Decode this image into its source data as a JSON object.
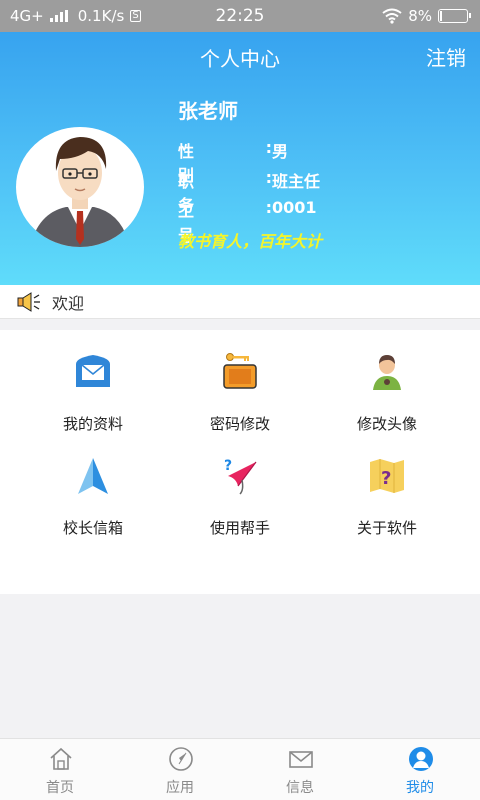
{
  "status_bar": {
    "network": "4G+",
    "speed": "0.1K/s",
    "sim": "S",
    "time": "22:25",
    "battery_percent": "8%",
    "battery_level": 0.08
  },
  "header": {
    "title": "个人中心",
    "logout": "注销",
    "name": "张老师",
    "fields": [
      {
        "key": "性别",
        "value": "男"
      },
      {
        "key": "职务",
        "value": "班主任"
      },
      {
        "key": "工号",
        "value": "0001"
      }
    ],
    "motto": "教书育人，百年大计"
  },
  "welcome": {
    "text": "欢迎"
  },
  "grid": {
    "items": [
      {
        "label": "我的资料",
        "icon": "mail-icon"
      },
      {
        "label": "密码修改",
        "icon": "key-briefcase-icon"
      },
      {
        "label": "修改头像",
        "icon": "user-avatar-icon"
      },
      {
        "label": "校长信箱",
        "icon": "navigation-arrow-icon"
      },
      {
        "label": "使用帮手",
        "icon": "help-umbrella-icon"
      },
      {
        "label": "关于软件",
        "icon": "map-question-icon"
      }
    ]
  },
  "tabbar": {
    "tabs": [
      {
        "label": "首页",
        "icon": "home-icon"
      },
      {
        "label": "应用",
        "icon": "compass-icon"
      },
      {
        "label": "信息",
        "icon": "envelope-icon"
      },
      {
        "label": "我的",
        "icon": "person-icon"
      }
    ],
    "active_index": 3
  },
  "colors": {
    "header_top": "#37a3ef",
    "header_bottom": "#5fdcfa",
    "motto": "#f5f52a",
    "active_tab": "#1f8ce8"
  }
}
